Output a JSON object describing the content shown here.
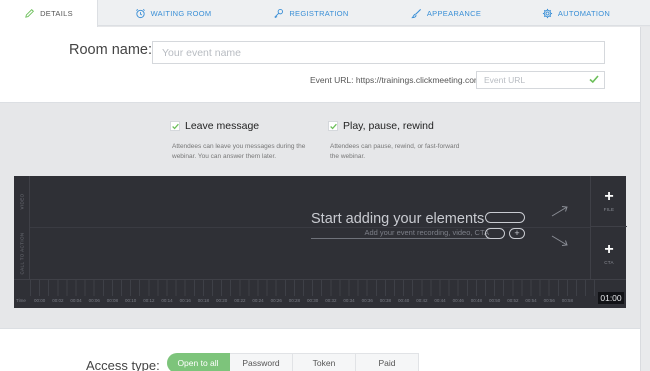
{
  "tabs": [
    {
      "label": "DETAILS",
      "icon": "pencil-icon"
    },
    {
      "label": "WAITING ROOM",
      "icon": "alarm-clock-icon"
    },
    {
      "label": "REGISTRATION",
      "icon": "key-icon"
    },
    {
      "label": "APPEARANCE",
      "icon": "brush-icon"
    },
    {
      "label": "AUTOMATION",
      "icon": "gear-icon"
    }
  ],
  "room": {
    "label": "Room name:",
    "placeholder": "Your event name",
    "value": ""
  },
  "event_url": {
    "label": "Event URL: https://trainings.clickmeeting.com/",
    "placeholder": "Event URL",
    "value": ""
  },
  "options": [
    {
      "title": "Leave message",
      "description": "Attendees can leave you messages during the webinar. You can answer them later.",
      "checked": true
    },
    {
      "title": "Play, pause, rewind",
      "description": "Attendees can pause, rewind, or fast-forward the webinar.",
      "checked": true
    }
  ],
  "editor": {
    "lanes": [
      "VIDEO",
      "CALL TO ACTION"
    ],
    "start_title": "Start adding your elements",
    "start_subtitle": "Add your event recording, video, CTA",
    "side_buttons": [
      {
        "symbol": "+",
        "label": "FILE"
      },
      {
        "symbol": "+",
        "label": "CTA"
      }
    ],
    "ruler_label": "Time",
    "ticks": [
      "00:00",
      "00:02",
      "00:04",
      "00:06",
      "00:08",
      "00:10",
      "00:12",
      "00:14",
      "00:16",
      "00:18",
      "00:20",
      "00:22",
      "00:24",
      "00:26",
      "00:28",
      "00:30",
      "00:32",
      "00:34",
      "00:36",
      "00:38",
      "00:40",
      "00:42",
      "00:44",
      "00:46",
      "00:48",
      "00:50",
      "00:52",
      "00:54",
      "00:56",
      "00:58"
    ],
    "current_time": "01:00"
  },
  "access": {
    "label": "Access type:",
    "options": [
      "Open to all",
      "Password",
      "Token",
      "Paid"
    ],
    "selected": "Open to all"
  },
  "colors": {
    "accent_blue": "#3a8fd6",
    "check_green": "#6bbf59",
    "active_green": "#7dc47b",
    "editor_bg": "#2f3036"
  }
}
